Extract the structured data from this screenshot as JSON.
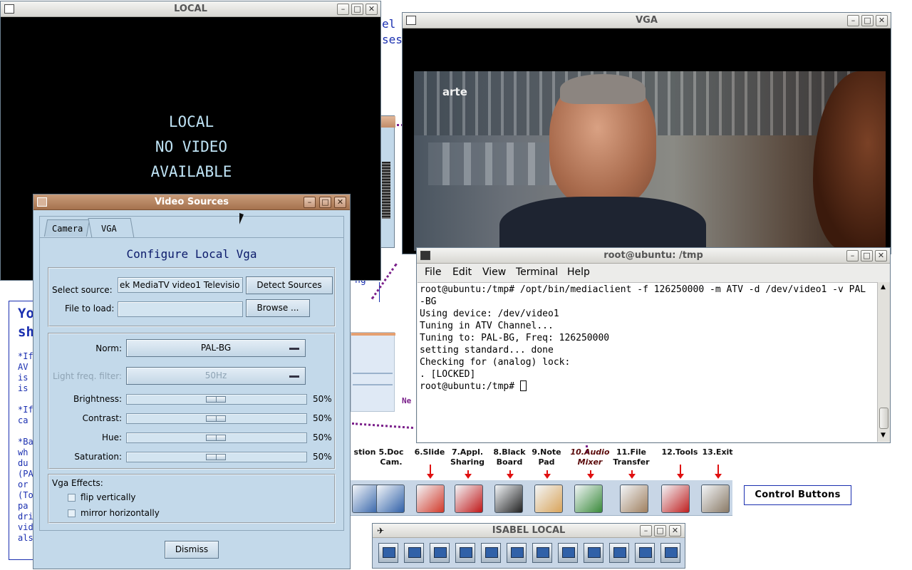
{
  "background_slide": {
    "frag_top1": "el h",
    "frag_top2": "ses",
    "frag_mid": "ng",
    "frag_yo": "Yo",
    "frag_sh": "sh",
    "left_lines": [
      "*If",
      "AV",
      "is",
      "is",
      "",
      "*If",
      "ca",
      "",
      "*Ba",
      "wh",
      "du",
      "(PA",
      "or",
      "(To",
      "pa",
      "dri",
      "vid",
      "als"
    ],
    "frag_ne": "Ne"
  },
  "local_window": {
    "title": "LOCAL",
    "line1": "LOCAL",
    "line2": "NO VIDEO",
    "line3": "AVAILABLE"
  },
  "vga_window": {
    "title": "VGA",
    "channel_logo": "arte"
  },
  "terminal": {
    "title": "root@ubuntu: /tmp",
    "menu": [
      "File",
      "Edit",
      "View",
      "Terminal",
      "Help"
    ],
    "lines": [
      "root@ubuntu:/tmp# /opt/bin/mediaclient -f 126250000 -m ATV -d /dev/video1 -v PAL",
      "-BG",
      "Using device: /dev/video1",
      "Tuning in ATV Channel...",
      "Tuning to: PAL-BG, Freq: 126250000",
      "setting standard... done",
      "Checking for (analog) lock:",
      ". [LOCKED]",
      "root@ubuntu:/tmp# "
    ]
  },
  "video_sources": {
    "title": "Video Sources",
    "tabs": [
      "Camera",
      "VGA"
    ],
    "heading": "Configure Local Vga",
    "select_source_label": "Select source:",
    "select_source_value": "ek MediaTV video1 Televisio",
    "detect_sources": "Detect Sources",
    "file_to_load_label": "File to load:",
    "file_to_load_value": "",
    "browse": "Browse ...",
    "norm_label": "Norm:",
    "norm_value": "PAL-BG",
    "light_filter_label": "Light freq. filter:",
    "light_filter_value": "50Hz",
    "sliders": [
      {
        "label": "Brightness:",
        "value": 50,
        "text": "50%"
      },
      {
        "label": "Contrast:",
        "value": 50,
        "text": "50%"
      },
      {
        "label": "Hue:",
        "value": 50,
        "text": "50%"
      },
      {
        "label": "Saturation:",
        "value": 50,
        "text": "50%"
      }
    ],
    "effects_label": "Vga Effects:",
    "flip_vertically": "flip vertically",
    "mirror_horizontally": "mirror horizontally",
    "dismiss": "Dismiss"
  },
  "toolbar": {
    "labels": [
      {
        "line1": "stion",
        "line2": ""
      },
      {
        "line1": "5.Doc",
        "line2": "Cam."
      },
      {
        "line1": "6.Slide",
        "line2": ""
      },
      {
        "line1": "7.Appl.",
        "line2": "Sharing"
      },
      {
        "line1": "8.Black",
        "line2": "Board"
      },
      {
        "line1": "9.Note",
        "line2": "Pad"
      },
      {
        "line1": "10.Audio",
        "line2": "Mixer"
      },
      {
        "line1": "11.File",
        "line2": "Transfer"
      },
      {
        "line1": "12.Tools",
        "line2": ""
      },
      {
        "line1": "13.Exit",
        "line2": ""
      }
    ],
    "control_buttons": "Control Buttons"
  },
  "isabel_local": {
    "title": "ISABEL LOCAL"
  },
  "colors": {
    "slide_blue": "#1a2fb0",
    "dialog_bg": "#c3d9ea",
    "arrow_red": "#e01010",
    "dotted_purple": "#7a1f8a"
  }
}
